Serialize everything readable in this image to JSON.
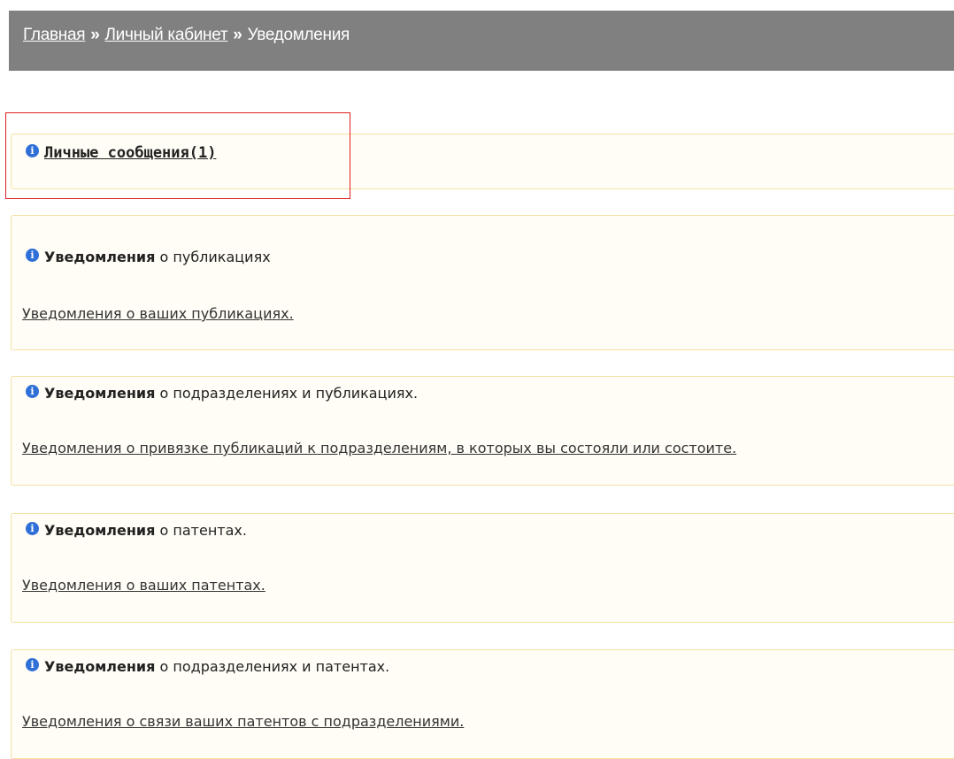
{
  "breadcrumb": {
    "home": "Главная",
    "separator": "»",
    "cabinet": "Личный кабинет",
    "current": "Уведомления"
  },
  "private_messages": {
    "label": "Личные сообщения(1)"
  },
  "panels": [
    {
      "title_bold": "Уведомления",
      "title_rest": " о публикациях",
      "link": "Уведомления о ваших публикациях."
    },
    {
      "title_bold": "Уведомления",
      "title_rest": " о подразделениях и публикациях.",
      "link": "Уведомления о привязке публикаций к подразделениям, в которых вы состояли или состоите."
    },
    {
      "title_bold": "Уведомления",
      "title_rest": " о патентах.",
      "link": "Уведомления о ваших патентах."
    },
    {
      "title_bold": "Уведомления",
      "title_rest": " о подразделениях и патентах.",
      "link": "Уведомления о связи ваших патентов с подразделениями."
    }
  ],
  "icons": {
    "info": "info-icon",
    "info_glyph": "i"
  },
  "colors": {
    "breadcrumb_bg": "#808080",
    "panel_bg": "#fffdf5",
    "panel_border": "#f3e2a6",
    "icon": "#2f6fd8",
    "highlight": "#e02020"
  }
}
